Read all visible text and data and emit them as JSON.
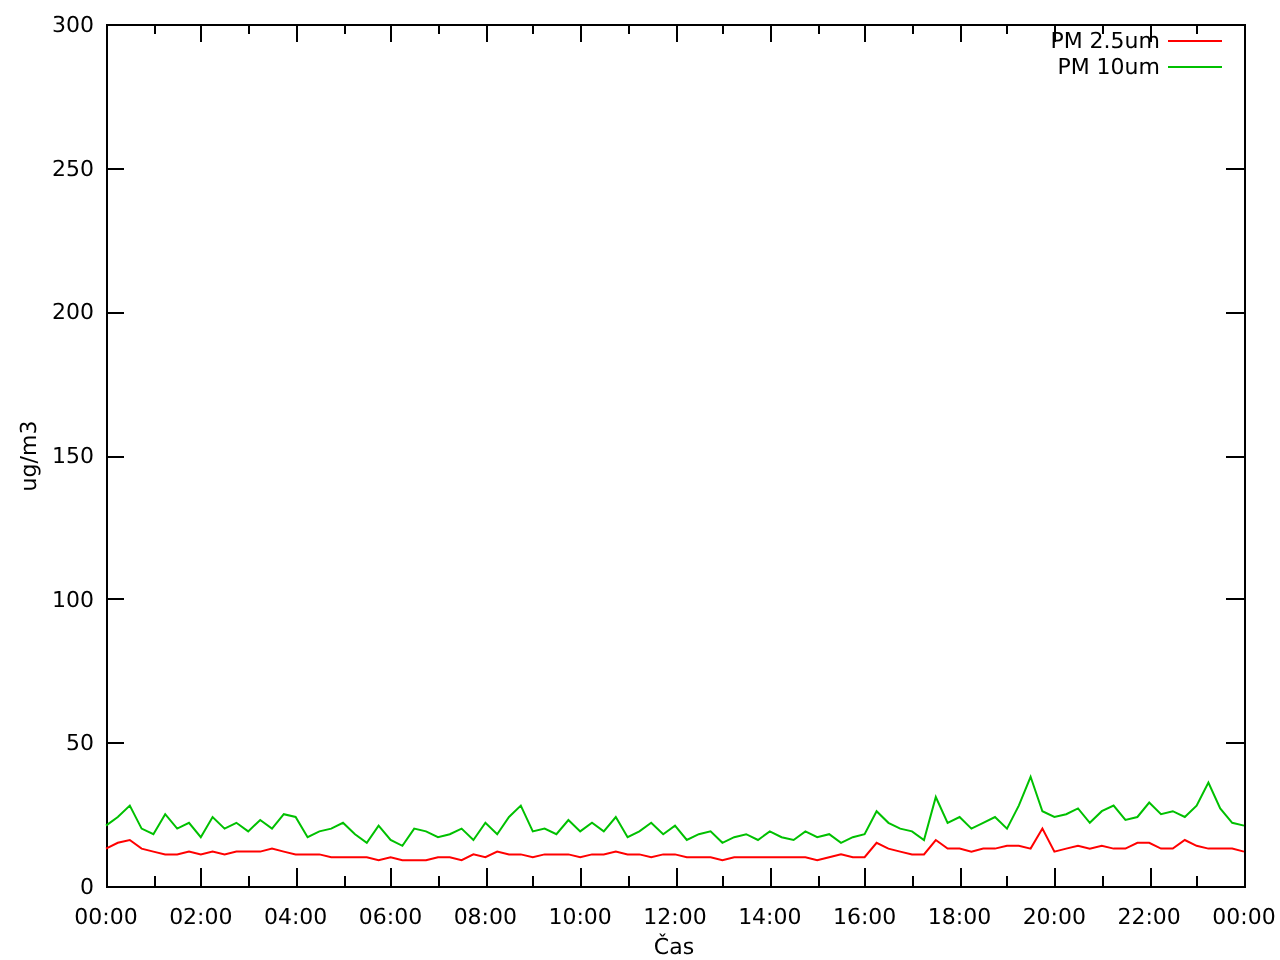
{
  "chart_data": {
    "type": "line",
    "xlabel": "Čas",
    "ylabel": "ug/m3",
    "x": [
      0,
      0.25,
      0.5,
      0.75,
      1,
      1.25,
      1.5,
      1.75,
      2,
      2.25,
      2.5,
      2.75,
      3,
      3.25,
      3.5,
      3.75,
      4,
      4.25,
      4.5,
      4.75,
      5,
      5.25,
      5.5,
      5.75,
      6,
      6.25,
      6.5,
      6.75,
      7,
      7.25,
      7.5,
      7.75,
      8,
      8.25,
      8.5,
      8.75,
      9,
      9.25,
      9.5,
      9.75,
      10,
      10.25,
      10.5,
      10.75,
      11,
      11.25,
      11.5,
      11.75,
      12,
      12.25,
      12.5,
      12.75,
      13,
      13.25,
      13.5,
      13.75,
      14,
      14.25,
      14.5,
      14.75,
      15,
      15.25,
      15.5,
      15.75,
      16,
      16.25,
      16.5,
      16.75,
      17,
      17.25,
      17.5,
      17.75,
      18,
      18.25,
      18.5,
      18.75,
      19,
      19.25,
      19.5,
      19.75,
      20,
      20.25,
      20.5,
      20.75,
      21,
      21.25,
      21.5,
      21.75,
      22,
      22.25,
      22.5,
      22.75,
      23,
      23.25,
      23.5,
      23.75,
      24
    ],
    "series": [
      {
        "name": "PM 2.5um",
        "color": "#ff0000",
        "values": [
          13,
          15,
          16,
          13,
          12,
          11,
          11,
          12,
          11,
          12,
          11,
          12,
          12,
          12,
          13,
          12,
          11,
          11,
          11,
          10,
          10,
          10,
          10,
          9,
          10,
          9,
          9,
          9,
          10,
          10,
          9,
          11,
          10,
          12,
          11,
          11,
          10,
          11,
          11,
          11,
          10,
          11,
          11,
          12,
          11,
          11,
          10,
          11,
          11,
          10,
          10,
          10,
          9,
          10,
          10,
          10,
          10,
          10,
          10,
          10,
          9,
          10,
          11,
          10,
          10,
          15,
          13,
          12,
          11,
          11,
          16,
          13,
          13,
          12,
          13,
          13,
          14,
          14,
          13,
          20,
          12,
          13,
          14,
          13,
          14,
          13,
          13,
          15,
          15,
          13,
          13,
          16,
          14,
          13,
          13,
          13,
          12
        ]
      },
      {
        "name": "PM 10um",
        "color": "#00c000",
        "values": [
          21,
          24,
          28,
          20,
          18,
          25,
          20,
          22,
          17,
          24,
          20,
          22,
          19,
          23,
          20,
          25,
          24,
          17,
          19,
          20,
          22,
          18,
          15,
          21,
          16,
          14,
          20,
          19,
          17,
          18,
          20,
          16,
          22,
          18,
          24,
          28,
          19,
          20,
          18,
          23,
          19,
          22,
          19,
          24,
          17,
          19,
          22,
          18,
          21,
          16,
          18,
          19,
          15,
          17,
          18,
          16,
          19,
          17,
          16,
          19,
          17,
          18,
          15,
          17,
          18,
          26,
          22,
          20,
          19,
          16,
          31,
          22,
          24,
          20,
          22,
          24,
          20,
          28,
          38,
          26,
          24,
          25,
          27,
          22,
          26,
          28,
          23,
          24,
          29,
          25,
          26,
          24,
          28,
          36,
          27,
          22,
          21
        ]
      }
    ],
    "legend": "top right",
    "xlim": [
      0,
      24
    ],
    "ylim": [
      0,
      300
    ],
    "xticks": [
      {
        "value": 0,
        "label": "00:00"
      },
      {
        "value": 2,
        "label": "02:00"
      },
      {
        "value": 4,
        "label": "04:00"
      },
      {
        "value": 6,
        "label": "06:00"
      },
      {
        "value": 8,
        "label": "08:00"
      },
      {
        "value": 10,
        "label": "10:00"
      },
      {
        "value": 12,
        "label": "12:00"
      },
      {
        "value": 14,
        "label": "14:00"
      },
      {
        "value": 16,
        "label": "16:00"
      },
      {
        "value": 18,
        "label": "18:00"
      },
      {
        "value": 20,
        "label": "20:00"
      },
      {
        "value": 22,
        "label": "22:00"
      },
      {
        "value": 24,
        "label": "00:00"
      }
    ],
    "yticks": [
      0,
      50,
      100,
      150,
      200,
      250,
      300
    ]
  }
}
